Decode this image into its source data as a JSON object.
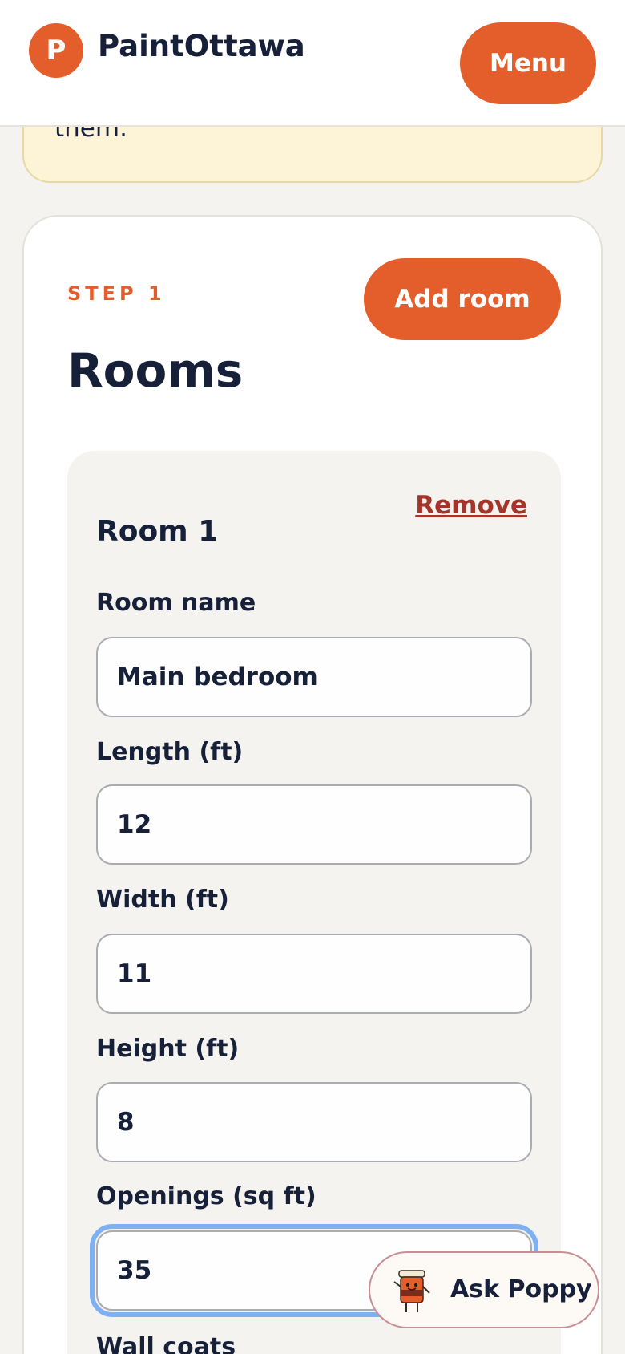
{
  "header": {
    "logo_letter": "P",
    "brand": "PaintOttawa",
    "menu_label": "Menu"
  },
  "notice": {
    "text_fragment": "them."
  },
  "rooms_card": {
    "step": "STEP 1",
    "title": "Rooms",
    "add_room_label": "Add room",
    "room": {
      "title": "Room 1",
      "remove_label": "Remove",
      "fields": [
        {
          "label": "Room name",
          "value": "Main bedroom"
        },
        {
          "label": "Length (ft)",
          "value": "12"
        },
        {
          "label": "Width (ft)",
          "value": "11"
        },
        {
          "label": "Height (ft)",
          "value": "8"
        },
        {
          "label": "Openings (sq ft)",
          "value": "35"
        }
      ],
      "next_label": "Wall coats"
    }
  },
  "assistant": {
    "label": "Ask Poppy",
    "icon": "paint-can-mascot-icon"
  },
  "colors": {
    "accent": "#e45e2b",
    "danger": "#a5342a",
    "focus": "#7fb0f2"
  }
}
